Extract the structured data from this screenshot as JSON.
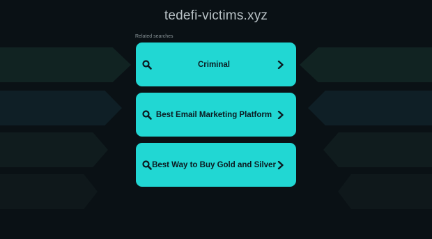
{
  "site": {
    "domain": "tedefi-victims.xyz"
  },
  "related": {
    "heading": "Related searches",
    "items": [
      {
        "label": "Criminal",
        "icon": "search-icon",
        "arrow": "chevron-right-icon"
      },
      {
        "label": "Best Email Marketing Platform",
        "icon": "search-icon",
        "arrow": "chevron-right-icon"
      },
      {
        "label": "Best Way to Buy Gold and Silver",
        "icon": "search-icon",
        "arrow": "chevron-right-icon"
      }
    ]
  },
  "colors": {
    "background": "#0a1115",
    "button": "#21d7d3",
    "button_text": "#0b1a20"
  }
}
